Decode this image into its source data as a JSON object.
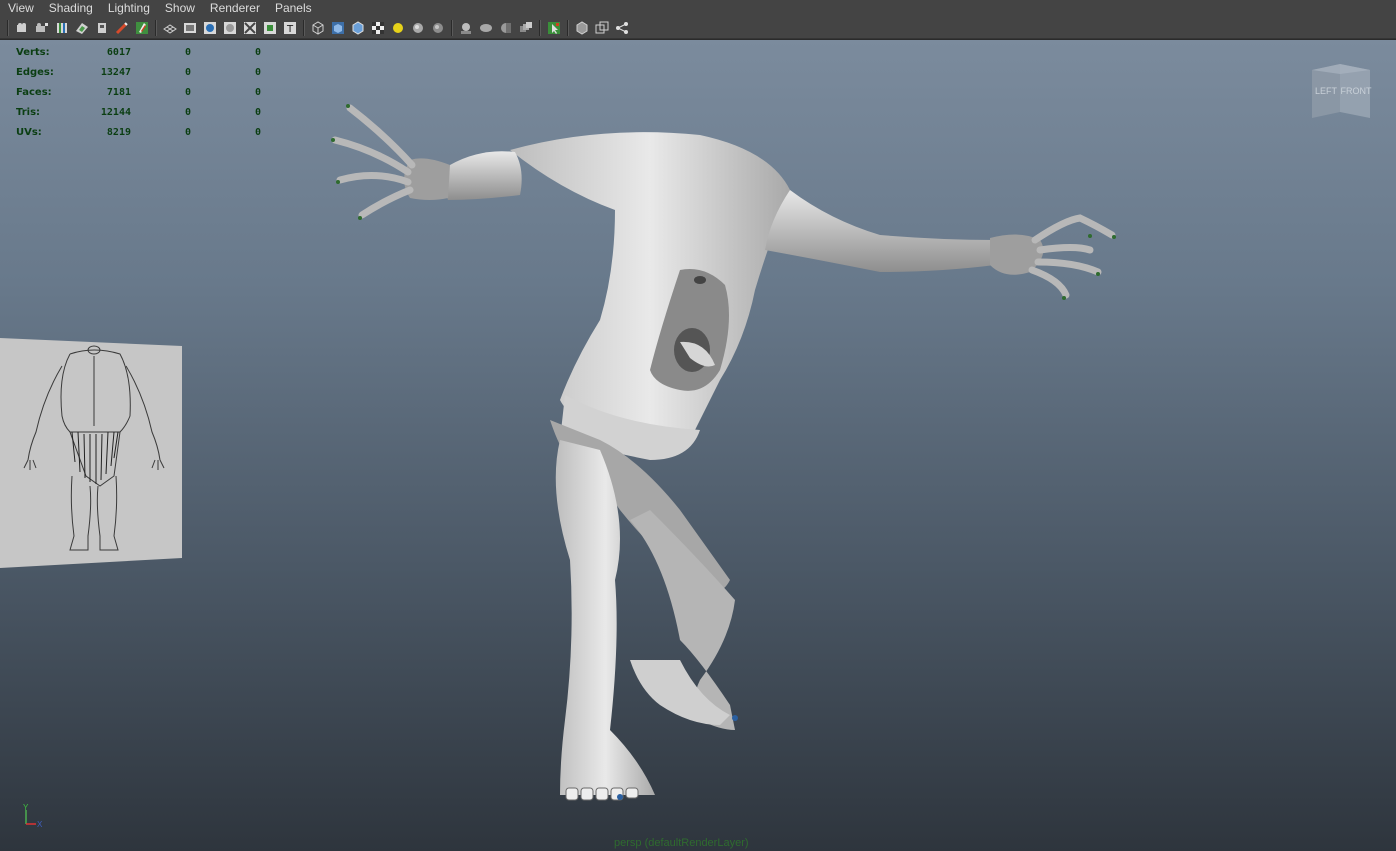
{
  "menubar": {
    "items": [
      {
        "label": "View"
      },
      {
        "label": "Shading"
      },
      {
        "label": "Lighting"
      },
      {
        "label": "Show"
      },
      {
        "label": "Renderer"
      },
      {
        "label": "Panels"
      }
    ]
  },
  "toolbar": {
    "icons": [
      "select-camera-icon",
      "camera-attributes-icon",
      "bookmarks-icon",
      "image-plane-icon",
      "2d-pan-zoom-icon",
      "grease-pencil-icon",
      "grid-icon",
      "film-gate-icon",
      "resolution-gate-icon",
      "gate-mask-icon",
      "field-chart-icon",
      "safe-action-icon",
      "safe-title-icon",
      "wireframe-icon",
      "smooth-shade-icon",
      "wireframe-on-shaded-icon",
      "textured-icon",
      "use-all-lights-icon",
      "shadows-icon",
      "screen-space-ao-icon",
      "motion-blur-icon",
      "multisample-aa-icon",
      "depth-of-field-icon",
      "isolate-select-icon",
      "xray-icon",
      "xray-active-components-icon",
      "xray-joints-icon"
    ]
  },
  "hud": {
    "rows": [
      {
        "label": "Verts:",
        "v1": "6017",
        "v2": "0",
        "v3": "0"
      },
      {
        "label": "Edges:",
        "v1": "13247",
        "v2": "0",
        "v3": "0"
      },
      {
        "label": "Faces:",
        "v1": "7181",
        "v2": "0",
        "v3": "0"
      },
      {
        "label": "Tris:",
        "v1": "12144",
        "v2": "0",
        "v3": "0"
      },
      {
        "label": "UVs:",
        "v1": "8219",
        "v2": "0",
        "v3": "0"
      }
    ]
  },
  "viewcube": {
    "left_face": "LEFT",
    "front_face": "FRONT"
  },
  "axis": {
    "y": "Y",
    "x": "X"
  },
  "camera_label": "persp (defaultRenderLayer)",
  "colors": {
    "panel_bg": "#444444",
    "hud_text": "#0b3e12",
    "camera_label": "#2f6b2f",
    "viewport_top": "#7b8b9d",
    "viewport_bottom": "#2e353d"
  }
}
